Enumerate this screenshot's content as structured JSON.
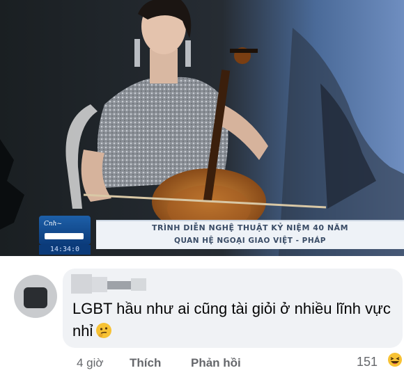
{
  "video": {
    "ticker_line1": "TRÌNH DIỄN NGHỆ THUẬT KỶ NIỆM 40 NĂM",
    "ticker_line2": "QUAN HỆ NGOẠI GIAO VIỆT - PHÁP",
    "clock": "14:34:0"
  },
  "comment": {
    "text": "LGBT hầu như ai cũng tài giỏi ở nhiều lĩnh vực nhỉ",
    "emoji": "thinking-face-emoji"
  },
  "actions": {
    "time": "4 giờ",
    "like": "Thích",
    "reply": "Phản hồi"
  },
  "reactions": {
    "count": "151",
    "icon": "haha-react-icon"
  },
  "colors": {
    "bubble": "#f0f2f5",
    "text": "#050505",
    "meta": "#65676b"
  }
}
